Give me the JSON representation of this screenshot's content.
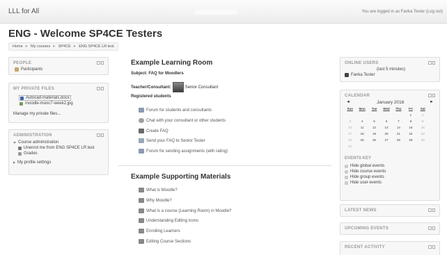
{
  "header": {
    "site_name": "LLL for All",
    "login_text": "You are logged in as Fanka Tester (Log out)"
  },
  "page": {
    "title": "ENG - Welcome SP4CE Testers"
  },
  "breadcrumb": [
    "Home",
    "My courses",
    "SP4CE",
    "ENG SP4CE LR test"
  ],
  "blocks": {
    "people": {
      "title": "PEOPLE",
      "items": [
        "Participants"
      ]
    },
    "private_files": {
      "title": "MY PRIVATE FILES",
      "files": [
        "Autocad-materials.docx",
        "moodle-mooc7-week2.jpg"
      ],
      "manage_link": "Manage my private files..."
    },
    "administration": {
      "title": "ADMINISTRATION",
      "course_admin": "Course administration",
      "unenrol": "Unenrol me from ENG SP4CE LR test",
      "grades": "Grades",
      "profile_settings": "My profile settings"
    },
    "online_users": {
      "title": "ONLINE USERS",
      "subtitle": "(last 5 minutes)",
      "users": [
        "Fanka Tester"
      ]
    },
    "calendar": {
      "title": "CALENDAR",
      "month": "January 2016",
      "prev": "◄",
      "next": "►",
      "weekdays": [
        "Sun",
        "Mon",
        "Tue",
        "Wed",
        "Thu",
        "Fri",
        "Sat"
      ],
      "weeks": [
        [
          "",
          "",
          "",
          "",
          "",
          "1",
          "2"
        ],
        [
          "3",
          "4",
          "5",
          "6",
          "7",
          "8",
          "9"
        ],
        [
          "10",
          "11",
          "12",
          "13",
          "14",
          "15",
          "16"
        ],
        [
          "17",
          "18",
          "19",
          "20",
          "21",
          "22",
          "23"
        ],
        [
          "24",
          "25",
          "26",
          "27",
          "28",
          "29",
          "30"
        ],
        [
          "31",
          "",
          "",
          "",
          "",
          "",
          ""
        ]
      ],
      "events_key_title": "EVENTS KEY",
      "events_key": [
        "Hide global events",
        "Hide course events",
        "Hide group events",
        "Hide user events"
      ]
    },
    "latest_news": {
      "title": "LATEST NEWS"
    },
    "upcoming_events": {
      "title": "UPCOMING EVENTS"
    },
    "recent_activity": {
      "title": "RECENT ACTIVITY"
    }
  },
  "main": {
    "section1": {
      "title": "Example Learning Room",
      "subject": "Subject: FAQ for Moodlers",
      "teacher_label": "Teacher/Consultant:",
      "teacher_name": "Senior Consultant",
      "registered": "Registered students",
      "activities": [
        "Forum for students and consultants",
        "Chat with your consultant or other students",
        "Create FAQ",
        "Send your FAQ to Senior Tester",
        "Forum for sending assignments (with rating)"
      ]
    },
    "section2": {
      "title": "Example Supporting Materials",
      "items": [
        "What is Moodle?",
        "Why Moodle?",
        "What is a course (Learning Room) in Moodle?",
        "Understanding Editing Icons",
        "Enrolling Learners",
        "Editing Course Sections"
      ]
    }
  },
  "colors": {
    "accent": "#e2701b",
    "link": "#555555",
    "block_bg": "#f7f7f7"
  }
}
